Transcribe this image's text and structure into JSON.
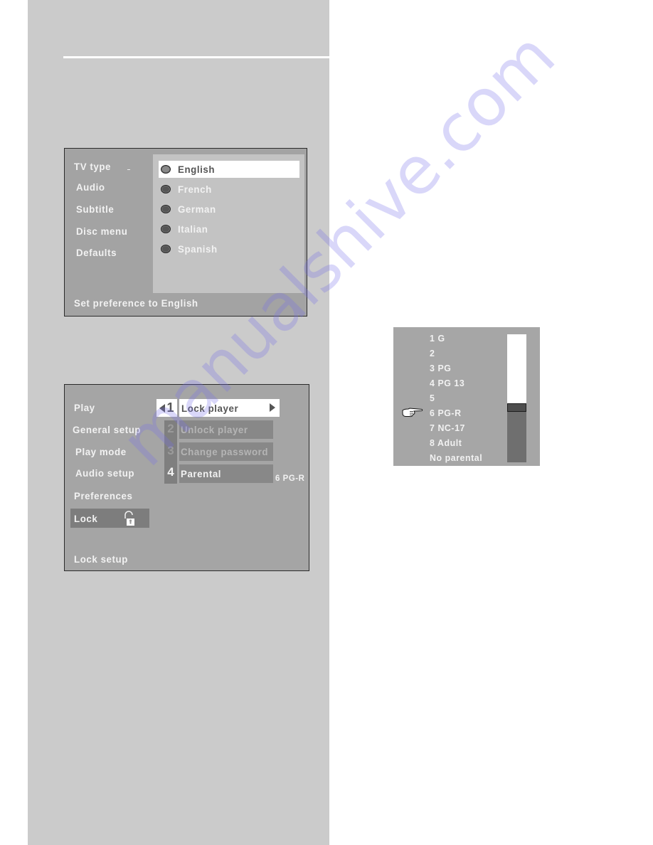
{
  "preferences_menu": {
    "categories": [
      "TV type",
      "Audio",
      "Subtitle",
      "Disc menu",
      "Defaults"
    ],
    "options": [
      {
        "label": "English",
        "selected": true
      },
      {
        "label": "French",
        "selected": false
      },
      {
        "label": "German",
        "selected": false
      },
      {
        "label": "Italian",
        "selected": false
      },
      {
        "label": "Spanish",
        "selected": false
      }
    ],
    "status": "Set preference to English"
  },
  "lock_menu": {
    "categories": [
      "Play",
      "General setup",
      "Play mode",
      "Audio setup",
      "Preferences",
      "Lock"
    ],
    "active_category": "Lock",
    "items": [
      {
        "number": "1",
        "label": "Lock player",
        "state": "selected"
      },
      {
        "number": "2",
        "label": "Unlock player",
        "state": "disabled"
      },
      {
        "number": "3",
        "label": "Change password",
        "state": "disabled"
      },
      {
        "number": "4",
        "label": "Parental",
        "state": "enabled"
      }
    ],
    "parental_value": "6 PG-R",
    "status": "Lock setup"
  },
  "parental_menu": {
    "ratings": [
      "1 G",
      "2",
      "3 PG",
      "4 PG 13",
      "5",
      "6 PG-R",
      "7 NC-17",
      "8 Adult",
      "No parental"
    ],
    "selected_index": 5,
    "level_fraction": 0.56
  },
  "colors": {
    "page_column": "#cbcbcb",
    "osd_background": "#a5a5a5",
    "highlight": "#ffffff",
    "osd_text": "#f2f2f2"
  },
  "watermark": "manualshive.com"
}
